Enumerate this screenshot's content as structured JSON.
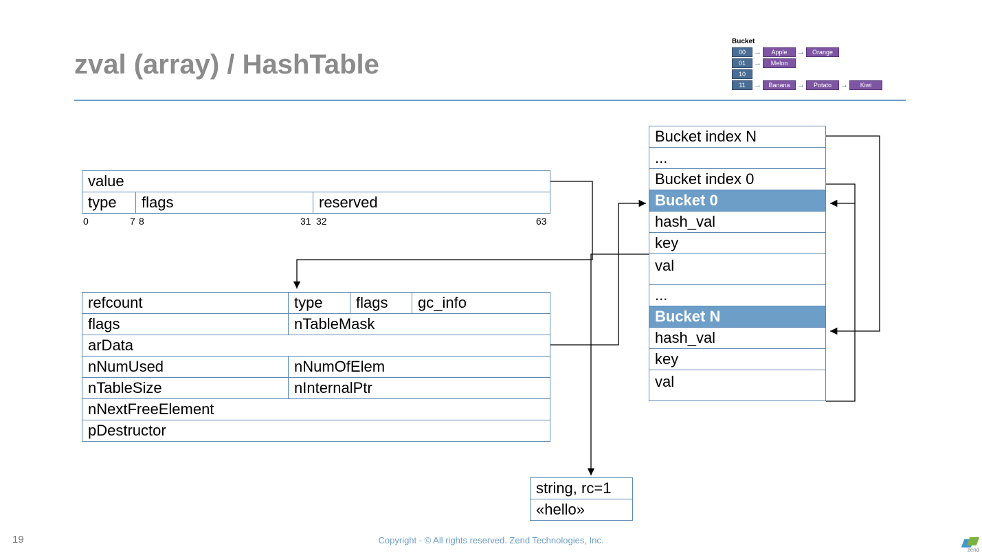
{
  "title": "zval (array) / HashTable",
  "footer": "Copyright - © All rights reserved. Zend Technologies, Inc.",
  "page": "19",
  "zval": {
    "value": "value",
    "type": "type",
    "flags": "flags",
    "reserved": "reserved",
    "bits": {
      "b0": "0",
      "b7": "7",
      "b8": "8",
      "b31": "31",
      "b32": "32",
      "b63": "63"
    }
  },
  "ht": {
    "refcount": "refcount",
    "type": "type",
    "flags": "flags",
    "gc_info": "gc_info",
    "flags2": "flags",
    "nTableMask": "nTableMask",
    "arData": "arData",
    "nNumUsed": "nNumUsed",
    "nNumOfElem": "nNumOfElem",
    "nTableSize": "nTableSize",
    "nInternalPtr": "nInternalPtr",
    "nNextFreeElement": "nNextFreeElement",
    "pDestructor": "pDestructor"
  },
  "buckets": {
    "idxN": "Bucket index N",
    "dots1": "...",
    "idx0": "Bucket index 0",
    "b0": "Bucket 0",
    "hash": "hash_val",
    "key": "key",
    "val": "val",
    "dots2": "...",
    "bN": "Bucket N"
  },
  "str": {
    "meta": "string, rc=1",
    "val": "«hello»"
  },
  "mini": {
    "header": "Bucket",
    "rows": [
      {
        "slot": "00",
        "items": [
          "Apple",
          "Orange"
        ]
      },
      {
        "slot": "01",
        "items": [
          "Melon"
        ]
      },
      {
        "slot": "10",
        "items": []
      },
      {
        "slot": "11",
        "items": [
          "Banana",
          "Potato",
          "Kiwi"
        ]
      }
    ]
  },
  "logo": "zend"
}
